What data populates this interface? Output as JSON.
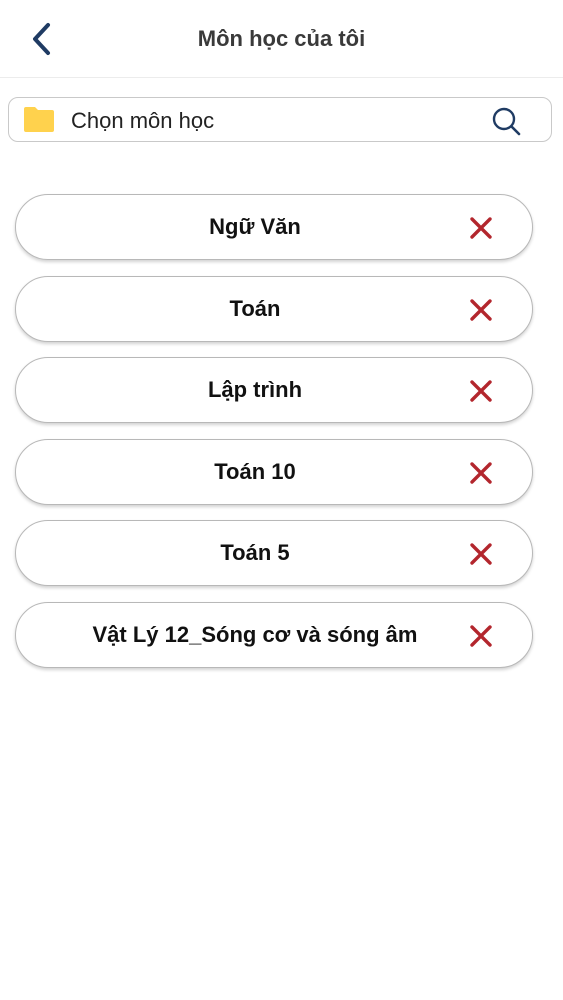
{
  "header": {
    "title": "Môn học của tôi",
    "back_icon": "chevron-left-icon"
  },
  "picker": {
    "label": "Chọn môn học",
    "folder_icon": "folder-icon",
    "search_icon": "search-icon"
  },
  "subjects": [
    {
      "name": "Ngữ Văn"
    },
    {
      "name": "Toán"
    },
    {
      "name": "Lập trình"
    },
    {
      "name": "Toán 10"
    },
    {
      "name": "Toán 5"
    },
    {
      "name": "Vật Lý 12_Sóng cơ và sóng âm"
    }
  ],
  "colors": {
    "accent_navy": "#1f3b63",
    "folder_yellow": "#ffd24d",
    "remove_red": "#b3262d"
  }
}
